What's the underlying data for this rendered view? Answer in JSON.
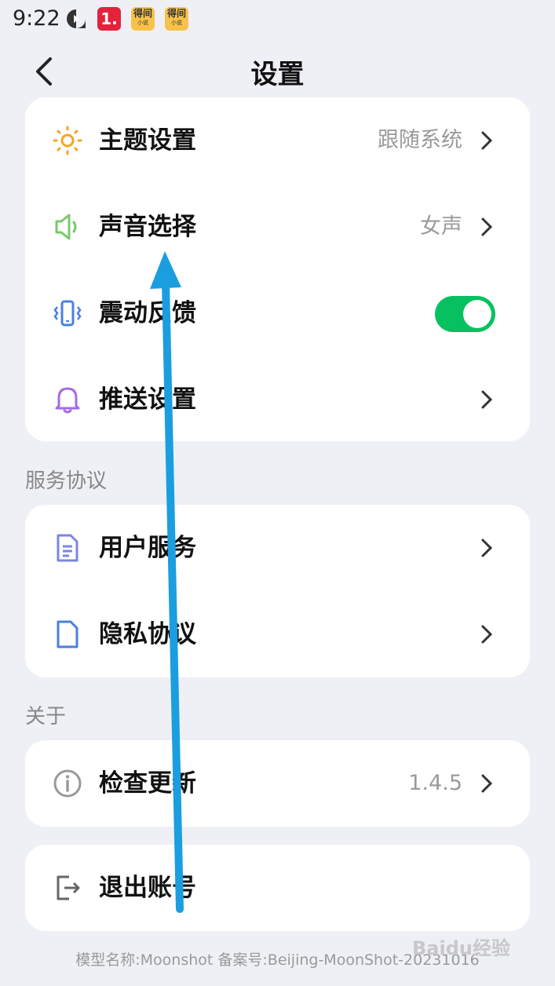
{
  "status_bar": {
    "time": "9:22",
    "app_badge": "1.",
    "app_label_1": "得间",
    "app_sub_1": "小说",
    "app_label_2": "得间",
    "app_sub_2": "小说"
  },
  "header": {
    "title": "设置"
  },
  "general": {
    "theme": {
      "label": "主题设置",
      "value": "跟随系统"
    },
    "voice": {
      "label": "声音选择",
      "value": "女声"
    },
    "vibration": {
      "label": "震动反馈",
      "enabled": true
    },
    "push": {
      "label": "推送设置"
    }
  },
  "service_section": {
    "title": "服务协议",
    "user_service": {
      "label": "用户服务"
    },
    "privacy": {
      "label": "隐私协议"
    }
  },
  "about_section": {
    "title": "关于",
    "check_update": {
      "label": "检查更新",
      "value": "1.4.5"
    }
  },
  "logout": {
    "label": "退出账号"
  },
  "footer": {
    "text": "模型名称:Moonshot 备案号:Beijing-MoonShot-20231016"
  },
  "watermark": {
    "text": "Baidu经验"
  },
  "colors": {
    "toggle_on": "#07c160",
    "arrow": "#1a9ee0",
    "theme_icon": "#f5a623",
    "voice_icon": "#7ac96b",
    "vibration_icon": "#4a7fe0",
    "push_icon": "#a46be8",
    "doc_icon": "#7b86e6"
  }
}
